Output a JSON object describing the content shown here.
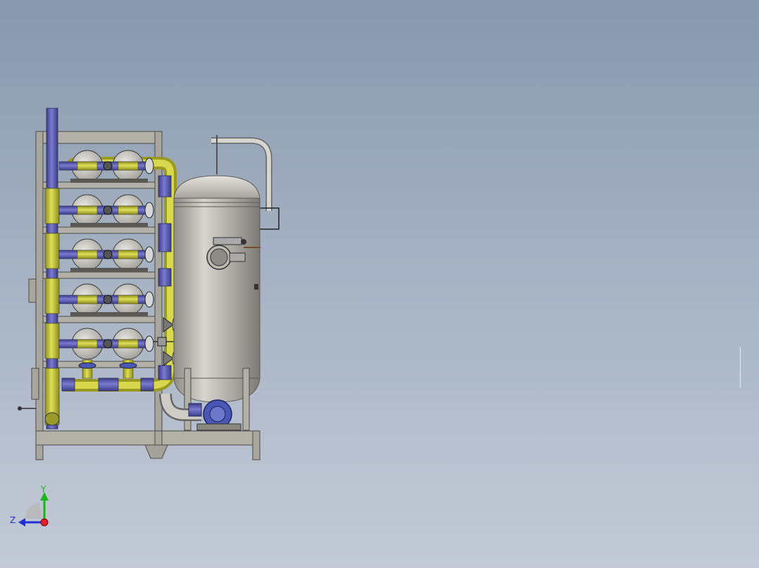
{
  "viewport": {
    "background_top": "#8898ad",
    "background_bottom": "#c3cad6"
  },
  "model": {
    "frame_color": "#b3b0a8",
    "pipe_blue": "#5e5fb3",
    "pipe_yellow": "#c8c83a",
    "tank_color": "#b9b6b0",
    "flange_blue": "#4a58b5",
    "housing_color": "#cfccc6",
    "shelf_count": 5,
    "housings_per_shelf": 2
  },
  "triad": {
    "y_label": "Y",
    "z_label": "Z",
    "y_color": "#1db31d",
    "z_color": "#2030d8",
    "x_color": "#e0202a"
  }
}
